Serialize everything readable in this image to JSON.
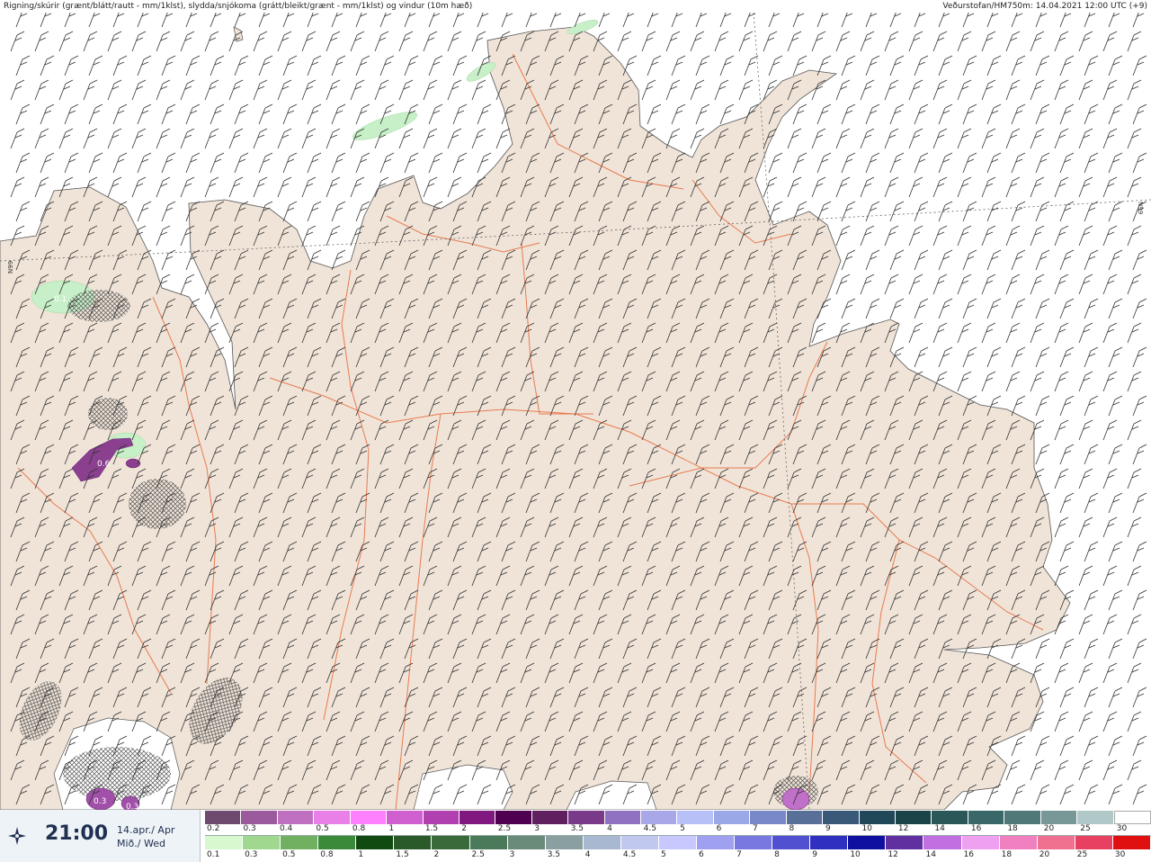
{
  "header": {
    "title": "Rigning/skúrir (grænt/blátt/rautt - mm/1klst), slydda/snjókoma (grátt/bleikt/grænt - mm/1klst) og vindur (10m hæð)",
    "source": "Veðurstofan/HM750m: 14.04.2021 12:00 UTC (+9)"
  },
  "map": {
    "lat_label_left": "N99",
    "lat_label_right": "N99",
    "value_labels": [
      "0.1",
      "0.6",
      "0.3",
      "0.3"
    ],
    "colors": {
      "land": "#f0e4d8",
      "sea": "#ffffff",
      "roads": "#e87a50",
      "rain_light": "#c8f0c8",
      "snow": "#8a3f8f"
    }
  },
  "footer": {
    "time": "21:00",
    "date": "14.apr./ Apr",
    "weekday": "Mið./ Wed",
    "icon": "compass-icon",
    "snow_scale": {
      "labels": [
        "0.2",
        "0.3",
        "0.4",
        "0.5",
        "0.8",
        "1",
        "1.5",
        "2",
        "2.5",
        "3",
        "3.5",
        "4",
        "4.5",
        "5",
        "6",
        "7",
        "8",
        "9",
        "10",
        "12",
        "14",
        "16",
        "18",
        "20",
        "25",
        "30"
      ],
      "colors": [
        "#6e4a6e",
        "#9b5a9b",
        "#c070c0",
        "#e880e8",
        "#ff80ff",
        "#d060d0",
        "#b040b0",
        "#801880",
        "#500050",
        "#602060",
        "#7a3a8a",
        "#9070c0",
        "#a8a8e8",
        "#b8c0f8",
        "#9aa8e8",
        "#7888c8",
        "#587098",
        "#3a5878",
        "#204858",
        "#1a4448",
        "#2a5858",
        "#3a6868",
        "#507878",
        "#789898",
        "#b0c8c8",
        "#ffffff"
      ]
    },
    "rain_scale": {
      "labels": [
        "0.1",
        "0.3",
        "0.5",
        "0.8",
        "1",
        "1.5",
        "2",
        "2.5",
        "3",
        "3.5",
        "4",
        "4.5",
        "5",
        "6",
        "7",
        "8",
        "9",
        "10",
        "12",
        "14",
        "16",
        "18",
        "20",
        "25",
        "30"
      ],
      "colors": [
        "#d8f8d0",
        "#a0d890",
        "#70b060",
        "#3a8a3a",
        "#104a10",
        "#2a5a2a",
        "#3a6a3a",
        "#4a7a5a",
        "#6a8a7a",
        "#8aa0a0",
        "#a8b8d0",
        "#c0c8f0",
        "#c8c8ff",
        "#a0a0f0",
        "#7878e0",
        "#5050d0",
        "#3030c0",
        "#1010a0",
        "#6030a0",
        "#c070e0",
        "#f0a0f0",
        "#f080c0",
        "#f07090",
        "#e84060",
        "#e01010"
      ]
    }
  }
}
